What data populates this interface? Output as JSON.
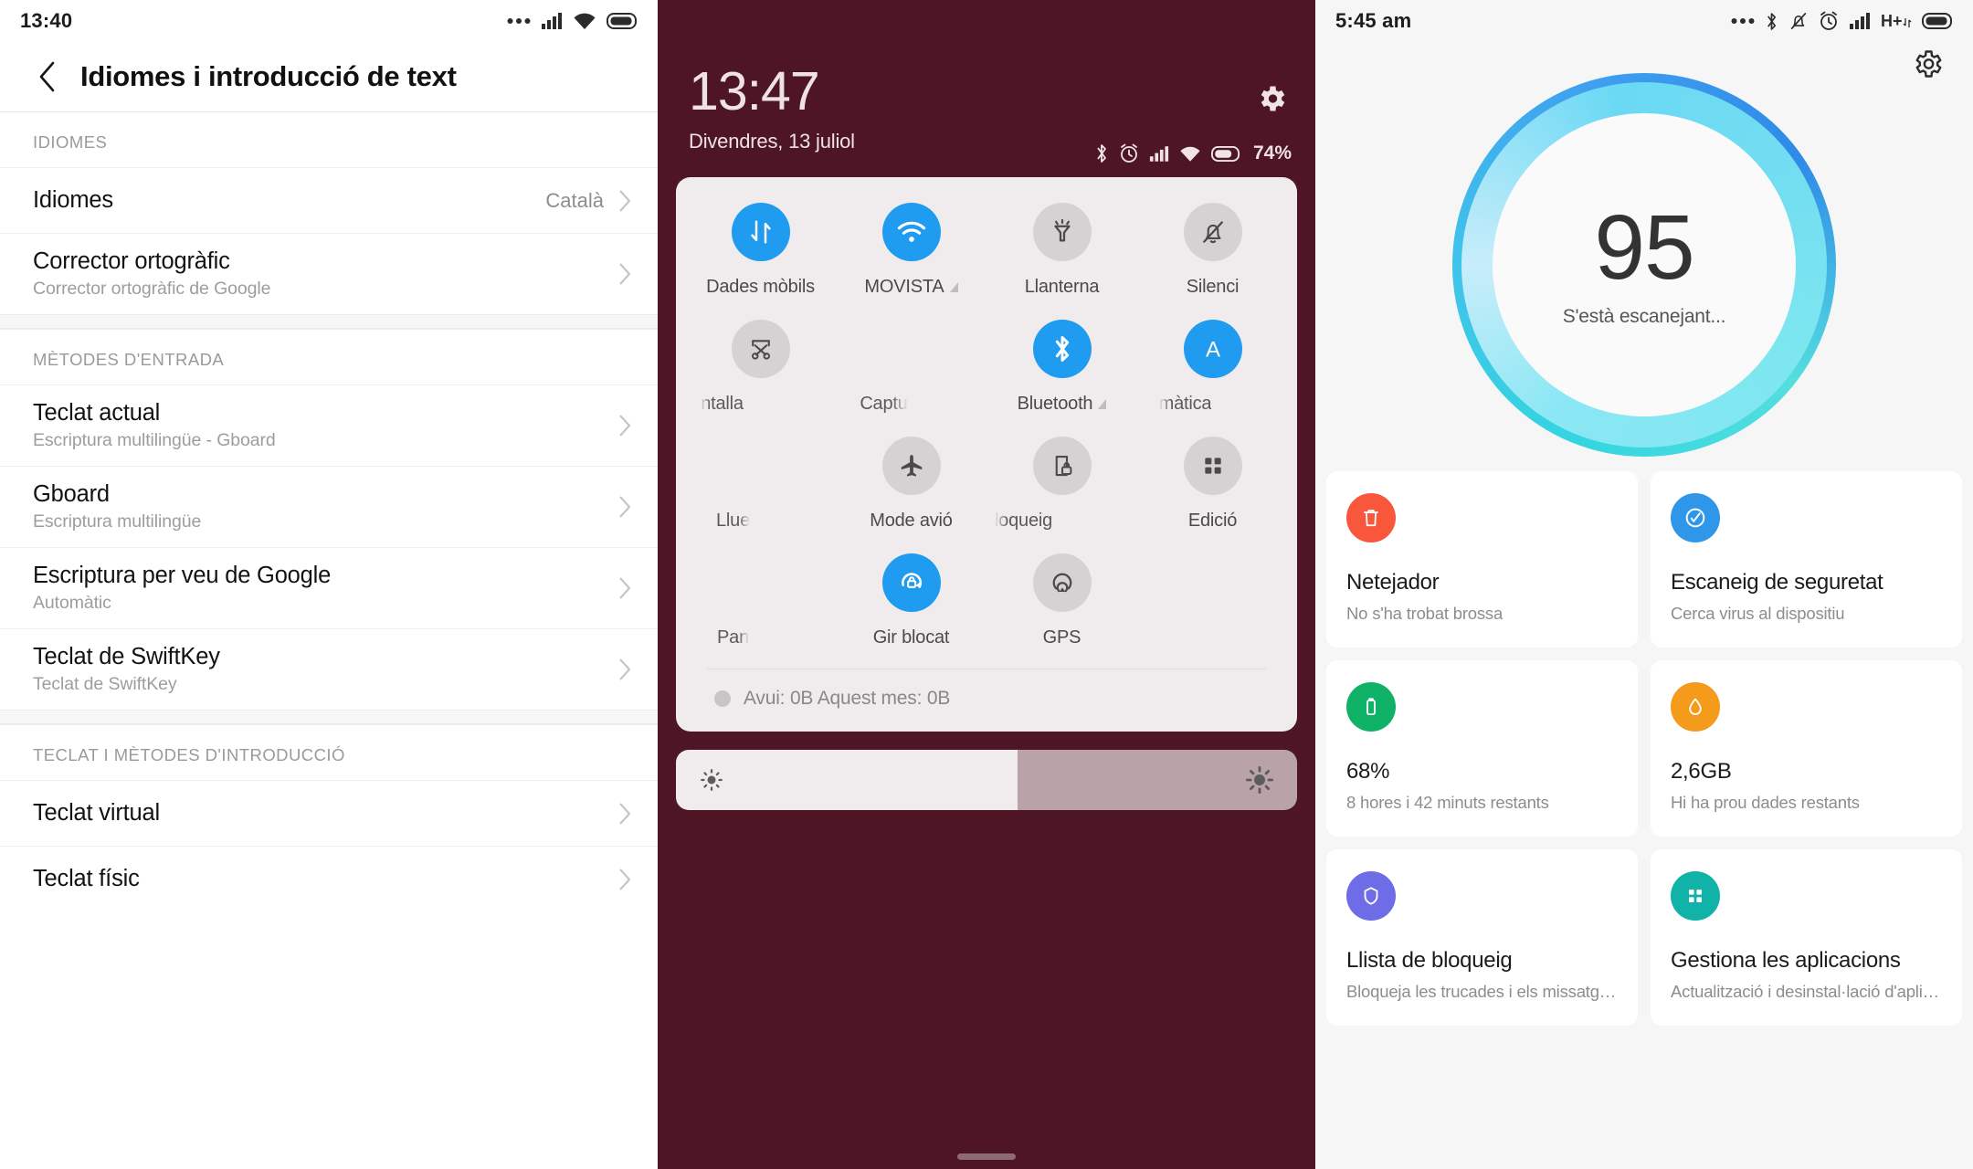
{
  "settings": {
    "statusbar": {
      "time": "13:40",
      "icons": [
        "more-icon",
        "signal-icon",
        "wifi-icon",
        "battery-icon"
      ]
    },
    "appbar": {
      "back_icon": "chevron-left-icon",
      "title": "Idiomes i introducció de text"
    },
    "sections": [
      {
        "header": "IDIOMES",
        "rows": [
          {
            "title": "Idiomes",
            "sub": "",
            "value": "Català"
          },
          {
            "title": "Corrector ortogràfic",
            "sub": "Corrector ortogràfic de Google",
            "value": ""
          }
        ]
      },
      {
        "header": "MÈTODES D'ENTRADA",
        "rows": [
          {
            "title": "Teclat actual",
            "sub": "Escriptura multilingüe - Gboard",
            "value": ""
          },
          {
            "title": "Gboard",
            "sub": "Escriptura multilingüe",
            "value": ""
          },
          {
            "title": "Escriptura per veu de Google",
            "sub": "Automàtic",
            "value": ""
          },
          {
            "title": "Teclat de SwiftKey",
            "sub": "Teclat de SwiftKey",
            "value": ""
          }
        ]
      },
      {
        "header": "TECLAT I MÈTODES D'INTRODUCCIÓ",
        "rows": [
          {
            "title": "Teclat virtual",
            "sub": "",
            "value": ""
          },
          {
            "title": "Teclat físic",
            "sub": "",
            "value": ""
          }
        ]
      }
    ]
  },
  "shade": {
    "clock": "13:47",
    "date": "Divendres, 13 juliol",
    "battery_percent": "74%",
    "gear_icon": "gear-icon",
    "status_icons": [
      "bluetooth-icon",
      "alarm-icon",
      "signal-icon",
      "wifi-icon",
      "battery-icon"
    ],
    "tiles": [
      {
        "label": "Dades mòbils",
        "icon": "data-transfer-icon",
        "on": true
      },
      {
        "label": "MOVISTA",
        "icon": "wifi-icon",
        "on": true,
        "badge": "signal-triangle"
      },
      {
        "label": "Llanterna",
        "icon": "flashlight-icon",
        "on": false
      },
      {
        "label": "Silenci",
        "icon": "bell-off-icon",
        "on": false
      },
      {
        "label": "ntalla",
        "icon": "screenshot-icon",
        "on": false
      },
      {
        "label": "Captu",
        "icon": "capture-icon",
        "on": false
      },
      {
        "label": "Bluetooth",
        "icon": "bluetooth-icon",
        "on": true,
        "badge": "signal-triangle"
      },
      {
        "label": "màtica",
        "icon": "auto-brightness-icon",
        "on": true
      },
      {
        "label": "Llue",
        "icon": "brightness-icon",
        "on": false
      },
      {
        "label": "Mode avió",
        "icon": "airplane-icon",
        "on": false
      },
      {
        "label": "loqueig",
        "icon": "screen-lock-icon",
        "on": false
      },
      {
        "label": "Pan",
        "icon": "panel-icon",
        "on": false
      },
      {
        "label": "Gir blocat",
        "icon": "rotation-lock-icon",
        "on": true
      },
      {
        "label": "GPS",
        "icon": "location-icon",
        "on": false
      },
      {
        "label": "Edició",
        "icon": "grid-edit-icon",
        "on": false
      }
    ],
    "usage": "Avui: 0B   Aquest mes: 0B",
    "brightness": {
      "icon_left": "brightness-low-icon",
      "icon_right": "brightness-high-icon",
      "percent": 55
    }
  },
  "security": {
    "statusbar": {
      "time": "5:45 am",
      "icons": [
        "more-icon",
        "bluetooth-icon",
        "mute-icon",
        "alarm-icon",
        "signal-icon",
        "h-plus-icon",
        "battery-icon"
      ]
    },
    "gear_icon": "gear-icon",
    "score": "95",
    "score_status": "S'està escanejant...",
    "cards": [
      {
        "title": "Netejador",
        "sub": "No s'ha trobat brossa",
        "icon": "trash-icon",
        "color": "#f8573c"
      },
      {
        "title": "Escaneig de seguretat",
        "sub": "Cerca virus al dispositiu",
        "icon": "scan-icon",
        "color": "#2f97ea"
      },
      {
        "title": "68%",
        "sub": "8 hores i 42 minuts  restants",
        "icon": "battery2-icon",
        "color": "#10b268"
      },
      {
        "title": "2,6GB",
        "sub": "Hi ha prou dades restants",
        "icon": "droplet-icon",
        "color": "#f59b1b"
      },
      {
        "title": "Llista de bloqueig",
        "sub": "Bloqueja les trucades i els missatg…",
        "icon": "shield-icon",
        "color": "#6f6ce8"
      },
      {
        "title": "Gestiona les aplicacions",
        "sub": "Actualització i desinstal·lació d'apli…",
        "icon": "apps-icon",
        "color": "#11b3a8"
      }
    ]
  },
  "colors": {
    "shade_bg": "#4e1624",
    "qs_on": "#1f9bf0",
    "qs_off": "#d6d2d3",
    "ring_cyan": "#33d6e0",
    "ring_blue": "#2f8ae8"
  }
}
